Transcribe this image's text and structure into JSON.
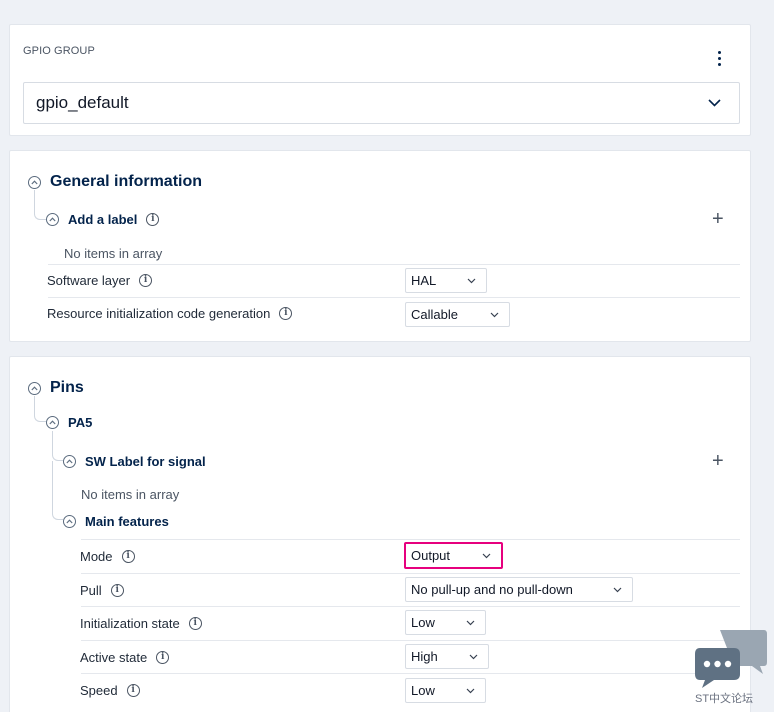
{
  "gpio_group": {
    "label": "GPIO GROUP",
    "selected": "gpio_default"
  },
  "general": {
    "title": "General information",
    "add_label": "Add a label",
    "no_items": "No items in array",
    "software_layer": {
      "label": "Software layer",
      "value": "HAL"
    },
    "resource_init": {
      "label": "Resource initialization code generation",
      "value": "Callable"
    }
  },
  "pins": {
    "title": "Pins",
    "pin": "PA5",
    "sw_label": "SW Label for signal",
    "no_items": "No items in array",
    "main_features": "Main features",
    "mode": {
      "label": "Mode",
      "value": "Output"
    },
    "pull": {
      "label": "Pull",
      "value": "No pull-up and no pull-down"
    },
    "init_state": {
      "label": "Initialization state",
      "value": "Low"
    },
    "active_state": {
      "label": "Active state",
      "value": "High"
    },
    "speed": {
      "label": "Speed",
      "value": "Low"
    }
  },
  "watermark": {
    "text": "ST中文论坛"
  },
  "colors": {
    "highlight": "#e6007e",
    "text": "#03234b",
    "background": "#eef1f6"
  }
}
